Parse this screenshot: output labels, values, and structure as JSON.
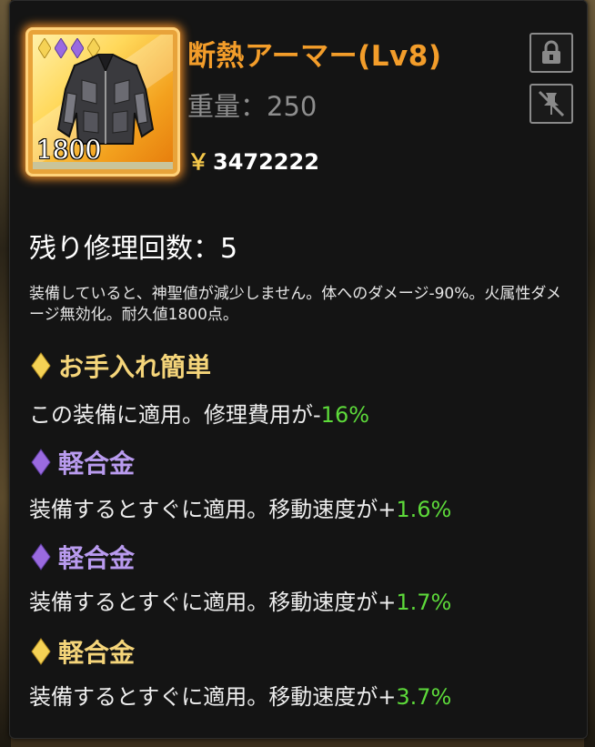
{
  "item": {
    "name": "断熱アーマー(Lv8)",
    "weight": "重量：250",
    "price_symbol": "￥",
    "price": "3472222",
    "count": "1800",
    "rarity_gems": [
      "gold",
      "purple",
      "purple",
      "gold"
    ]
  },
  "icons": {
    "lock": "lock-icon",
    "unpin": "unpin-icon"
  },
  "repair": "残り修理回数：5",
  "description": "装備していると、神聖値が減少しません。体へのダメージ-90%。火属性ダメージ無効化。耐久値1800点。",
  "stats": [
    {
      "gem": "gold",
      "title": "お手入れ簡単",
      "desc_prefix": "この装備に適用。修理費用が-",
      "value": "16%"
    },
    {
      "gem": "purple",
      "title": "軽合金",
      "desc_prefix": "装備するとすぐに適用。移動速度が+",
      "value": "1.6%"
    },
    {
      "gem": "purple",
      "title": "軽合金",
      "desc_prefix": "装備するとすぐに適用。移動速度が+",
      "value": "1.7%"
    },
    {
      "gem": "gold",
      "title": "軽合金",
      "desc_prefix": "装備するとすぐに適用。移動速度が+",
      "value": "3.7%"
    }
  ],
  "colors": {
    "gold_gem": "#f5d255",
    "purple_gem": "#9a6ae0",
    "item_name": "#f39d2a",
    "value_green": "#5dda3a",
    "glow": "#ff9628"
  }
}
